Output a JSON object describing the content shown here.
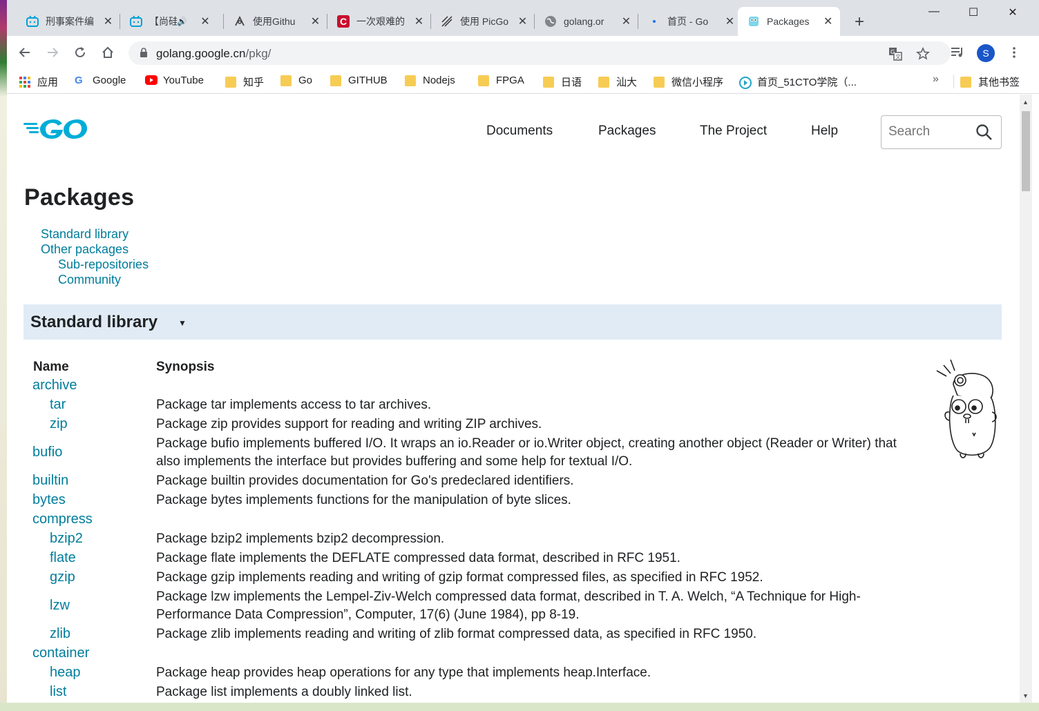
{
  "tabs": [
    {
      "title": "刑事案件编",
      "icon": "bilibili-icon",
      "close": "✕"
    },
    {
      "title": "【尚硅",
      "icon": "bilibili-icon",
      "close": "✕",
      "audio": "🔊"
    },
    {
      "title": "使用Githu",
      "icon": "github-icon",
      "close": "✕"
    },
    {
      "title": "一次艰难的",
      "icon": "csdn-icon",
      "close": "✕"
    },
    {
      "title": "使用 PicGo",
      "icon": "picgo-icon",
      "close": "✕"
    },
    {
      "title": "golang.or",
      "icon": "globe-icon",
      "close": "✕"
    },
    {
      "title": "首页 - Go",
      "icon": "loading-dot-icon",
      "close": "✕"
    },
    {
      "title": "Packages",
      "icon": "gopher-icon",
      "close": "✕",
      "active": true
    }
  ],
  "window": {
    "new_tab": "+",
    "minimize": "—",
    "maximize": "☐",
    "close": "✕"
  },
  "toolbar": {
    "url_host": "golang.google.cn",
    "url_path": "/pkg/",
    "avatar_letter": "S"
  },
  "bookmarks": [
    {
      "label": "应用",
      "icon": "apps-grid-icon"
    },
    {
      "label": "Google",
      "icon": "google-icon"
    },
    {
      "label": "YouTube",
      "icon": "youtube-icon"
    },
    {
      "label": "知乎",
      "icon": "folder-icon"
    },
    {
      "label": "Go",
      "icon": "folder-icon"
    },
    {
      "label": "GITHUB",
      "icon": "folder-icon"
    },
    {
      "label": "Nodejs",
      "icon": "folder-icon"
    },
    {
      "label": "FPGA",
      "icon": "folder-icon"
    },
    {
      "label": "日语",
      "icon": "folder-icon"
    },
    {
      "label": "汕大",
      "icon": "folder-icon"
    },
    {
      "label": "微信小程序",
      "icon": "folder-icon"
    },
    {
      "label": "首页_51CTO学院（...",
      "icon": "51cto-icon"
    },
    {
      "label": "其他书签",
      "icon": "folder-icon"
    }
  ],
  "bookmarks_more": "»",
  "site": {
    "nav": [
      "Documents",
      "Packages",
      "The Project",
      "Help"
    ],
    "search_placeholder": "Search",
    "page_title": "Packages",
    "toc": [
      "Standard library",
      "Other packages",
      "Sub-repositories",
      "Community"
    ],
    "section_title": "Standard library",
    "section_caret": "▼",
    "col_name": "Name",
    "col_synopsis": "Synopsis",
    "packages": [
      {
        "name": "archive",
        "synopsis": ""
      },
      {
        "name": "tar",
        "synopsis": "Package tar implements access to tar archives."
      },
      {
        "name": "zip",
        "synopsis": "Package zip provides support for reading and writing ZIP archives."
      },
      {
        "name": "bufio",
        "synopsis": "Package bufio implements buffered I/O. It wraps an io.Reader or io.Writer object, creating another object (Reader or Writer) that also implements the interface but provides buffering and some help for textual I/O."
      },
      {
        "name": "builtin",
        "synopsis": "Package builtin provides documentation for Go's predeclared identifiers."
      },
      {
        "name": "bytes",
        "synopsis": "Package bytes implements functions for the manipulation of byte slices."
      },
      {
        "name": "compress",
        "synopsis": ""
      },
      {
        "name": "bzip2",
        "synopsis": "Package bzip2 implements bzip2 decompression."
      },
      {
        "name": "flate",
        "synopsis": "Package flate implements the DEFLATE compressed data format, described in RFC 1951."
      },
      {
        "name": "gzip",
        "synopsis": "Package gzip implements reading and writing of gzip format compressed files, as specified in RFC 1952."
      },
      {
        "name": "lzw",
        "synopsis": "Package lzw implements the Lempel-Ziv-Welch compressed data format, described in T. A. Welch, “A Technique for High-Performance Data Compression”, Computer, 17(6) (June 1984), pp 8-19."
      },
      {
        "name": "zlib",
        "synopsis": "Package zlib implements reading and writing of zlib format compressed data, as specified in RFC 1950."
      },
      {
        "name": "container",
        "synopsis": ""
      },
      {
        "name": "heap",
        "synopsis": "Package heap provides heap operations for any type that implements heap.Interface."
      },
      {
        "name": "list",
        "synopsis": "Package list implements a doubly linked list."
      }
    ]
  },
  "colors": {
    "link": "#007d9c",
    "section_bg": "#e0ebf5",
    "go_blue": "#00add8"
  }
}
